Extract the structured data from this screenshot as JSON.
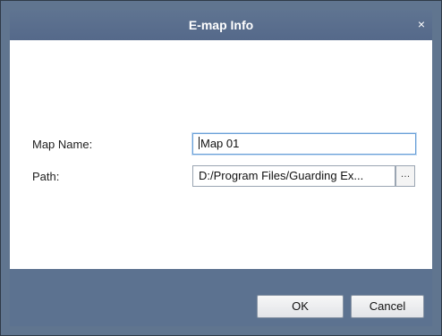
{
  "dialog": {
    "title": "E-map Info",
    "close_glyph": "×"
  },
  "form": {
    "map_name_label": "Map Name:",
    "map_name_value": "Map 01",
    "path_label": "Path:",
    "path_value": "D:/Program Files/Guarding Ex...",
    "browse_label": "…"
  },
  "footer": {
    "ok_label": "OK",
    "cancel_label": "Cancel"
  },
  "colors": {
    "title_bar": "#5a6f8c",
    "footer": "#5c7290",
    "focus_border": "#6aa0d8"
  }
}
